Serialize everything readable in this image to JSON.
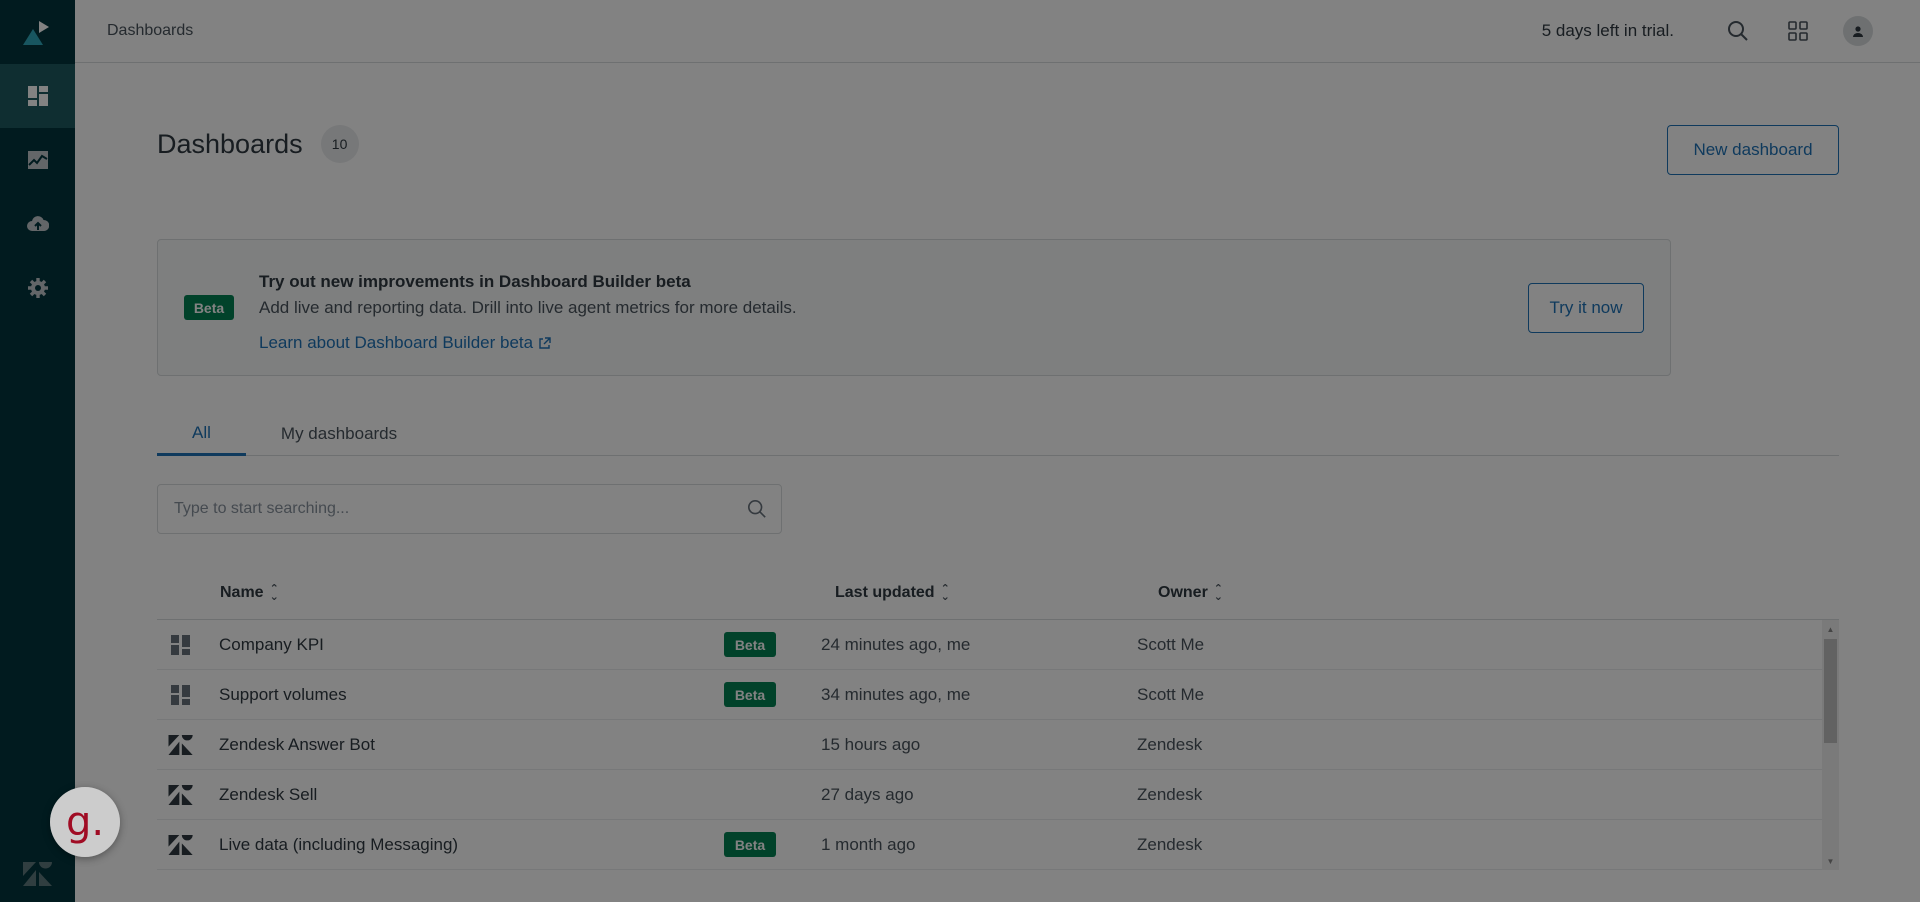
{
  "topbar": {
    "breadcrumb": "Dashboards",
    "trial_text": "5 days left in trial.",
    "icons": [
      "search-icon",
      "apps-grid-icon",
      "user-avatar-icon"
    ]
  },
  "sidebar": {
    "items": [
      {
        "name": "dashboards",
        "icon": "dashboard-icon",
        "active": true
      },
      {
        "name": "reports",
        "icon": "chart-icon",
        "active": false
      },
      {
        "name": "data-upload",
        "icon": "cloud-upload-icon",
        "active": false
      },
      {
        "name": "settings",
        "icon": "gear-icon",
        "active": false
      }
    ]
  },
  "page": {
    "title": "Dashboards",
    "count": "10",
    "new_button": "New dashboard"
  },
  "banner": {
    "badge": "Beta",
    "title": "Try out new improvements in Dashboard Builder beta",
    "description": "Add live and reporting data. Drill into live agent metrics for more details.",
    "link": "Learn about Dashboard Builder beta",
    "button": "Try it now"
  },
  "tabs": [
    {
      "label": "All",
      "active": true
    },
    {
      "label": "My dashboards",
      "active": false
    }
  ],
  "search": {
    "placeholder": "Type to start searching...",
    "value": ""
  },
  "table": {
    "columns": [
      "Name",
      "Last updated",
      "Owner"
    ],
    "rows": [
      {
        "icon": "dashboard-icon",
        "name": "Company KPI",
        "badge": "Beta",
        "updated": "24 minutes ago, me",
        "owner": "Scott Me"
      },
      {
        "icon": "dashboard-icon",
        "name": "Support volumes",
        "badge": "Beta",
        "updated": "34 minutes ago, me",
        "owner": "Scott Me"
      },
      {
        "icon": "zendesk-logo-icon",
        "name": "Zendesk Answer Bot",
        "badge": null,
        "updated": "15 hours ago",
        "owner": "Zendesk"
      },
      {
        "icon": "zendesk-logo-icon",
        "name": "Zendesk Sell",
        "badge": null,
        "updated": "27 days ago",
        "owner": "Zendesk"
      },
      {
        "icon": "zendesk-logo-icon",
        "name": "Live data (including Messaging)",
        "badge": "Beta",
        "updated": "1 month ago",
        "owner": "Zendesk"
      }
    ]
  },
  "widget": {
    "letter": "g."
  },
  "colors": {
    "sidebar": "#03363d",
    "accent": "#1f73b7",
    "beta": "#038153",
    "widget": "#c8102e"
  }
}
